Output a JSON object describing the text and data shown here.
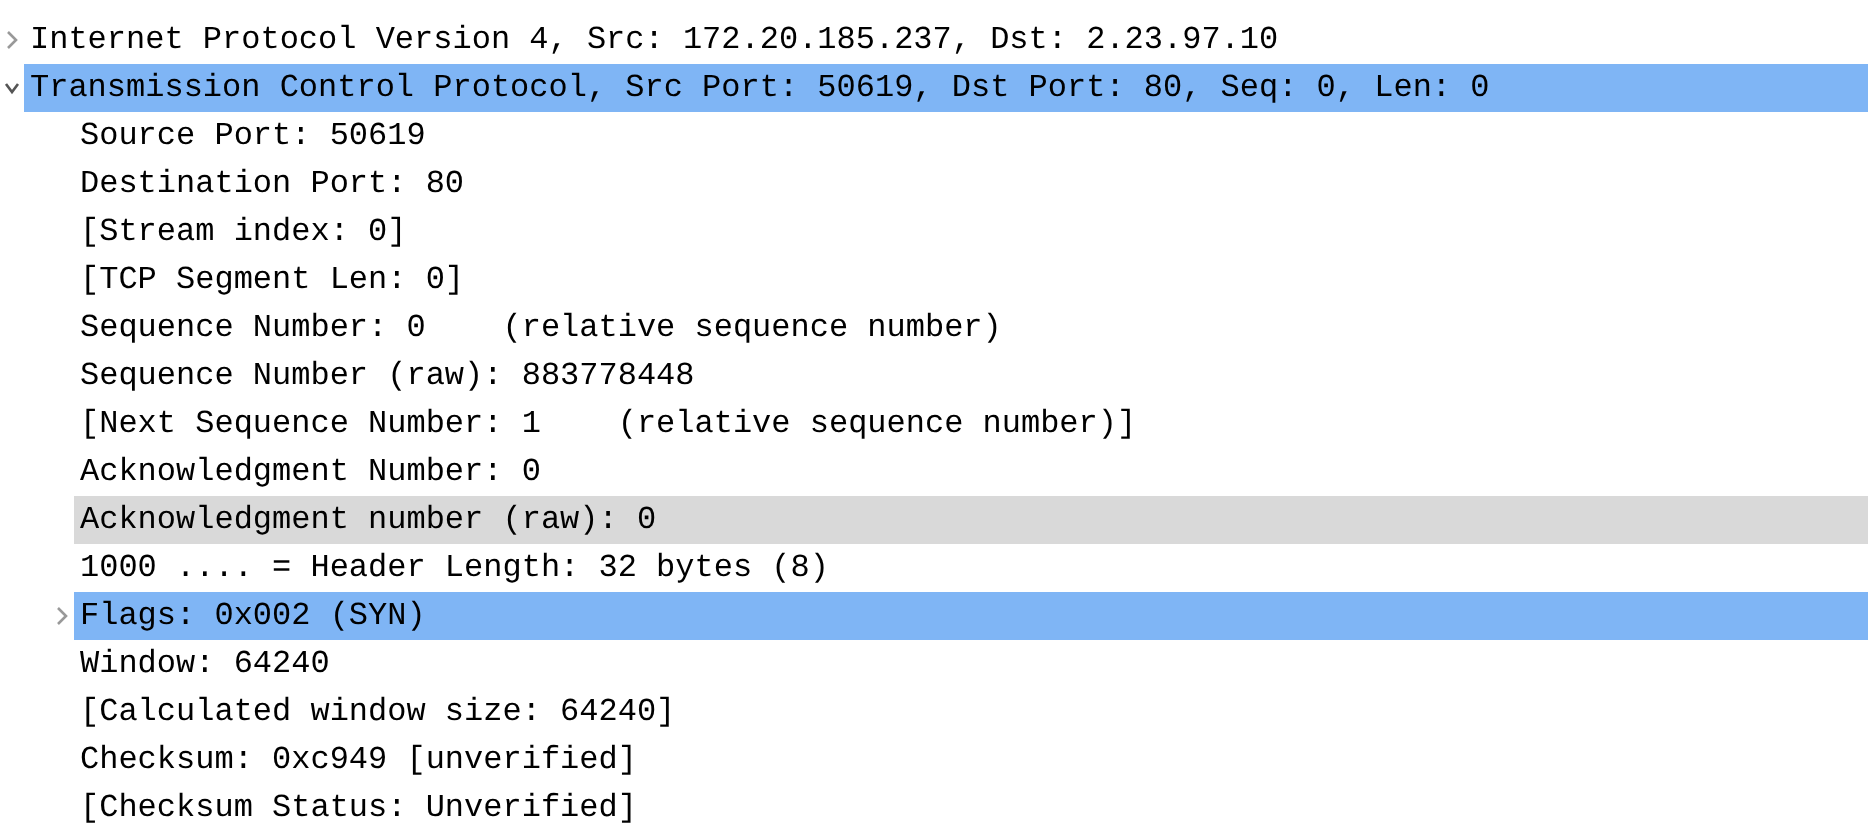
{
  "tree": [
    {
      "label": "Internet Protocol Version 4, Src: 172.20.185.237, Dst: 2.23.97.10",
      "expanded": false,
      "selected": false,
      "hovered": false
    },
    {
      "label": "Transmission Control Protocol, Src Port: 50619, Dst Port: 80, Seq: 0, Len: 0",
      "expanded": true,
      "selected": true,
      "hovered": false,
      "children": [
        {
          "label": "Source Port: 50619",
          "selected": false,
          "hovered": false
        },
        {
          "label": "Destination Port: 80",
          "selected": false,
          "hovered": false
        },
        {
          "label": "[Stream index: 0]",
          "selected": false,
          "hovered": false
        },
        {
          "label": "[TCP Segment Len: 0]",
          "selected": false,
          "hovered": false
        },
        {
          "label": "Sequence Number: 0    (relative sequence number)",
          "selected": false,
          "hovered": false
        },
        {
          "label": "Sequence Number (raw): 883778448",
          "selected": false,
          "hovered": false
        },
        {
          "label": "[Next Sequence Number: 1    (relative sequence number)]",
          "selected": false,
          "hovered": false
        },
        {
          "label": "Acknowledgment Number: 0",
          "selected": false,
          "hovered": false
        },
        {
          "label": "Acknowledgment number (raw): 0",
          "selected": false,
          "hovered": true
        },
        {
          "label": "1000 .... = Header Length: 32 bytes (8)",
          "selected": false,
          "hovered": false
        },
        {
          "label": "Flags: 0x002 (SYN)",
          "expanded": false,
          "selected": true,
          "hovered": false
        },
        {
          "label": "Window: 64240",
          "selected": false,
          "hovered": false
        },
        {
          "label": "[Calculated window size: 64240]",
          "selected": false,
          "hovered": false
        },
        {
          "label": "Checksum: 0xc949 [unverified]",
          "selected": false,
          "hovered": false
        },
        {
          "label": "[Checksum Status: Unverified]",
          "selected": false,
          "hovered": false
        }
      ]
    }
  ]
}
